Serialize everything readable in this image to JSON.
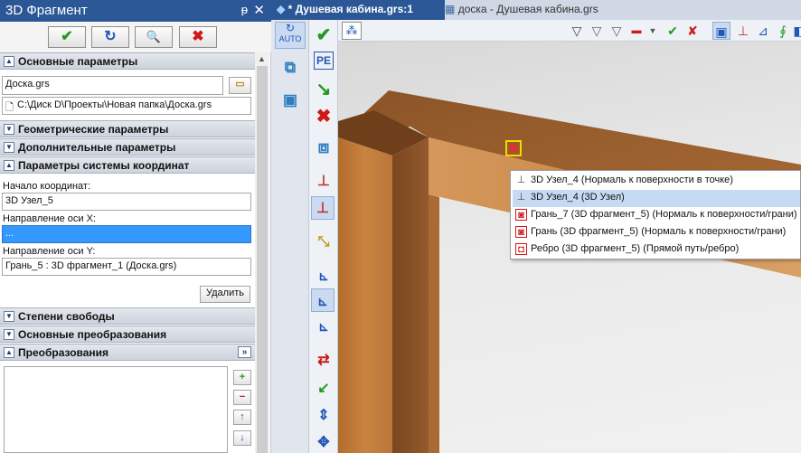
{
  "panel": {
    "title": "3D Фрагмент",
    "pin_glyph": "ᵽ",
    "close_glyph": "✕",
    "toolbar": {
      "ok_glyph": "✔",
      "refresh_glyph": "↻",
      "preview_glyph": "🔍",
      "cancel_glyph": "✖"
    },
    "sections": {
      "basic_params": "Основные параметры",
      "geometric_params": "Геометрические параметры",
      "additional_params": "Дополнительные параметры",
      "coord_system_params": "Параметры системы координат",
      "degrees_of_freedom": "Степени свободы",
      "basic_transforms": "Основные преобразования",
      "transforms": "Преобразования"
    },
    "file_name": "Доска.grs",
    "file_path": "C:\\Диск D\\Проекты\\Новая папка\\Доска.grs",
    "origin_label": "Начало координат:",
    "origin_value": "3D Узел_5",
    "x_axis_label": "Направление оси X:",
    "x_axis_value": "...",
    "y_axis_label": "Направление оси Y:",
    "y_axis_value": "Грань_5 : 3D фрагмент_1 (Доска.grs)",
    "delete_button": "Удалить",
    "expand_glyph": "»",
    "side_buttons": [
      "+",
      "−",
      "↑",
      "↓"
    ]
  },
  "tabs": [
    {
      "label": "* Душевая кабина.grs:1",
      "active": true
    },
    {
      "label": "доска - Душевая кабина.grs",
      "active": false
    }
  ],
  "vtoolbar": {
    "auto_label": "AUTO"
  },
  "context_menu": {
    "items": [
      {
        "label": "3D Узел_4 (Нормаль к поверхности в точке)",
        "icon": "node-icon",
        "highlighted": false
      },
      {
        "label": "3D Узел_4 (3D Узел)",
        "icon": "node-icon",
        "highlighted": true
      },
      {
        "label": "Грань_7 (3D фрагмент_5) (Нормаль к поверхности/грани)",
        "icon": "face-icon",
        "highlighted": false
      },
      {
        "label": "Грань (3D фрагмент_5) (Нормаль к поверхности/грани)",
        "icon": "face-icon",
        "highlighted": false
      },
      {
        "label": "Ребро (3D фрагмент_5) (Прямой путь/ребро)",
        "icon": "edge-icon",
        "highlighted": false
      }
    ]
  },
  "colors": {
    "title_bar": "#2b5797",
    "selected_field": "#3399ff",
    "wood_light": "#c98a4c",
    "wood_dark": "#8b5427",
    "menu_highlight": "#c6dbf3"
  }
}
